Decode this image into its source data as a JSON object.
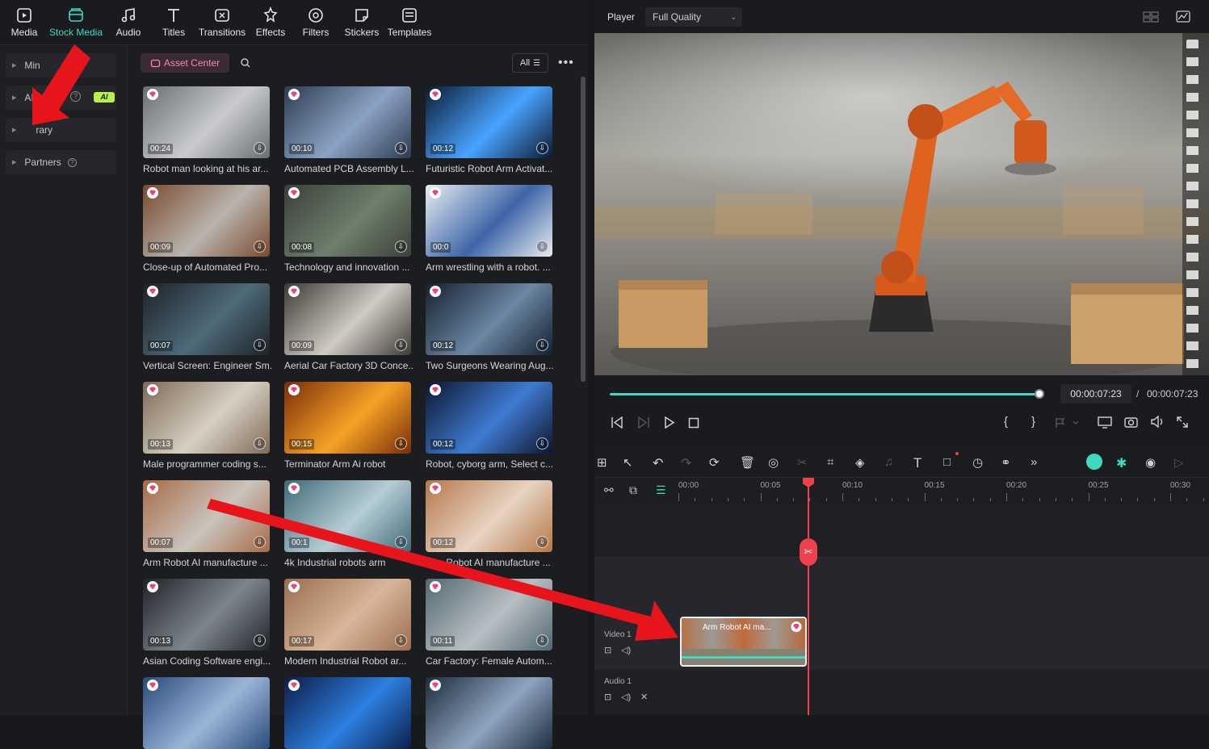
{
  "toolbar": {
    "tabs": [
      {
        "label": "Media",
        "icon": "media-icon"
      },
      {
        "label": "Stock Media",
        "icon": "stock-media-icon",
        "active": true
      },
      {
        "label": "Audio",
        "icon": "audio-icon"
      },
      {
        "label": "Titles",
        "icon": "titles-icon"
      },
      {
        "label": "Transitions",
        "icon": "transitions-icon"
      },
      {
        "label": "Effects",
        "icon": "effects-icon"
      },
      {
        "label": "Filters",
        "icon": "filters-icon"
      },
      {
        "label": "Stickers",
        "icon": "stickers-icon"
      },
      {
        "label": "Templates",
        "icon": "templates-icon"
      }
    ]
  },
  "sidebar": {
    "items": [
      {
        "label": "Min"
      },
      {
        "label": "AI"
      },
      {
        "label": "rary"
      },
      {
        "label": "Partners"
      }
    ],
    "ai_badge": "AI"
  },
  "content": {
    "asset_center_label": "Asset Center",
    "filter_label": "All",
    "cards": [
      {
        "duration": "00:24",
        "caption": "Robot man looking at his ar..."
      },
      {
        "duration": "00:10",
        "caption": "Automated PCB Assembly L..."
      },
      {
        "duration": "00:12",
        "caption": "Futuristic Robot Arm Activat..."
      },
      {
        "duration": "00:09",
        "caption": "Close-up of Automated Pro..."
      },
      {
        "duration": "00:08",
        "caption": "Technology and innovation ..."
      },
      {
        "duration": "00:0",
        "caption": "Arm wrestling with a robot. ..."
      },
      {
        "duration": "00:07",
        "caption": "Vertical Screen: Engineer Sm..."
      },
      {
        "duration": "00:09",
        "caption": "Aerial Car Factory 3D Conce..."
      },
      {
        "duration": "00:12",
        "caption": "Two Surgeons Wearing Aug..."
      },
      {
        "duration": "00:13",
        "caption": "Male programmer coding s..."
      },
      {
        "duration": "00:15",
        "caption": "Terminator Arm Ai robot"
      },
      {
        "duration": "00:12",
        "caption": "Robot, cyborg arm,  Select c..."
      },
      {
        "duration": "00:07",
        "caption": "Arm Robot AI manufacture ..."
      },
      {
        "duration": "00:1",
        "caption": "4k Industrial robots arm"
      },
      {
        "duration": "00:12",
        "caption": "Arm Robot AI manufacture ..."
      },
      {
        "duration": "00:13",
        "caption": "Asian Coding Software engi..."
      },
      {
        "duration": "00:17",
        "caption": "Modern Industrial Robot ar..."
      },
      {
        "duration": "00:11",
        "caption": "Car Factory: Female Autom..."
      },
      {
        "duration": "",
        "caption": ""
      },
      {
        "duration": "",
        "caption": ""
      },
      {
        "duration": "",
        "caption": ""
      }
    ]
  },
  "player": {
    "label": "Player",
    "quality": "Full Quality",
    "current_time": "00:00:07:23",
    "separator": "/",
    "total_time": "00:00:07:23",
    "progress": 1.0
  },
  "timeline": {
    "ruler": [
      "00:00",
      "00:05",
      "00:10",
      "00:15",
      "00:20",
      "00:25",
      "00:30"
    ],
    "video_track": "Video 1",
    "audio_track": "Audio 1",
    "clip_label": "Arm Robot AI ma..."
  },
  "colors": {
    "accent": "#3fd9c0",
    "playhead": "#f0414f",
    "annotation_arrow": "#e8141c",
    "premium_gem": "#f0417f"
  }
}
